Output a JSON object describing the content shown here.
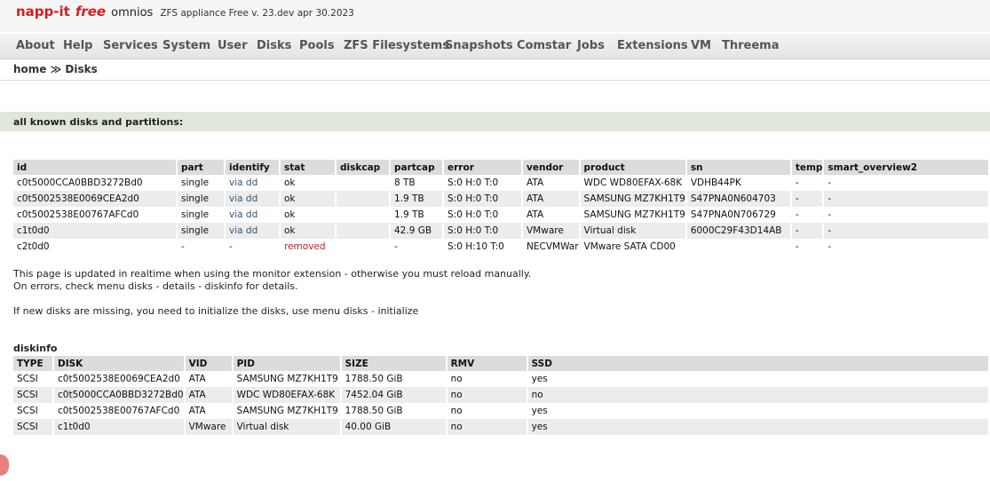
{
  "header": {
    "brand_part1": "napp-it",
    "brand_part2": "free",
    "os": "omnios",
    "version": "ZFS appliance Free v. 23.dev apr 30.2023"
  },
  "menu": [
    "About",
    "Help",
    "Services",
    "System",
    "User",
    "Disks",
    "Pools",
    "ZFS Filesystems",
    "Snapshots",
    "Comstar",
    "Jobs",
    "Extensions",
    "VM",
    "Threema"
  ],
  "breadcrumb": {
    "home": "home",
    "sep": "≫",
    "current": "Disks"
  },
  "section_title": "all known disks and partitions:",
  "disks": {
    "columns": [
      "id",
      "part",
      "identify",
      "stat",
      "diskcap",
      "partcap",
      "error",
      "vendor",
      "product",
      "sn",
      "temp",
      "smart_overview2"
    ],
    "rows": [
      [
        "c0t5000CCA0BBD3272Bd0",
        "single",
        "via dd",
        "ok",
        "",
        "8 TB",
        "S:0 H:0 T:0",
        "ATA",
        "WDC WD80EFAX-68K",
        "VDHB44PK",
        "-",
        "-"
      ],
      [
        "c0t5002538E0069CEA2d0",
        "single",
        "via dd",
        "ok",
        "",
        "1.9 TB",
        "S:0 H:0 T:0",
        "ATA",
        "SAMSUNG MZ7KH1T9",
        "S47PNA0N604703",
        "-",
        "-"
      ],
      [
        "c0t5002538E00767AFCd0",
        "single",
        "via dd",
        "ok",
        "",
        "1.9 TB",
        "S:0 H:0 T:0",
        "ATA",
        "SAMSUNG MZ7KH1T9",
        "S47PNA0N706729",
        "-",
        "-"
      ],
      [
        "c1t0d0",
        "single",
        "via dd",
        "ok",
        "",
        "42.9 GB",
        "S:0 H:0 T:0",
        "VMware",
        "Virtual disk",
        "6000C29F43D14AB",
        "-",
        "-"
      ],
      [
        "c2t0d0",
        "-",
        "-",
        "removed",
        "",
        "-",
        "S:0 H:10 T:0",
        "NECVMWar",
        "VMware SATA CD00",
        "",
        "-",
        "-"
      ]
    ]
  },
  "notes": {
    "line1": "This page is updated in realtime when using the monitor extension - otherwise you must reload manually.",
    "line2": "On errors, check menu disks - details - diskinfo for details.",
    "line3": "If new disks are missing, you need to initialize the disks, use menu disks - initialize"
  },
  "diskinfo": {
    "title": "diskinfo",
    "columns": [
      "TYPE",
      "DISK",
      "VID",
      "PID",
      "SIZE",
      "RMV",
      "SSD"
    ],
    "rows": [
      [
        "SCSI",
        "c0t5002538E0069CEA2d0",
        "ATA",
        "SAMSUNG MZ7KH1T9",
        "1788.50 GiB",
        "no",
        "yes"
      ],
      [
        "SCSI",
        "c0t5000CCA0BBD3272Bd0",
        "ATA",
        "WDC WD80EFAX-68K",
        "7452.04 GiB",
        "no",
        "no"
      ],
      [
        "SCSI",
        "c0t5002538E00767AFCd0",
        "ATA",
        "SAMSUNG MZ7KH1T9",
        "1788.50 GiB",
        "no",
        "yes"
      ],
      [
        "SCSI",
        "c1t0d0",
        "VMware",
        "Virtual disk",
        " 40.00 GiB",
        "no",
        "yes"
      ]
    ]
  },
  "colors": {
    "accent": "#cc2222",
    "section_bg": "#dfe7dc",
    "link": "#335577",
    "error": "#c02020"
  }
}
